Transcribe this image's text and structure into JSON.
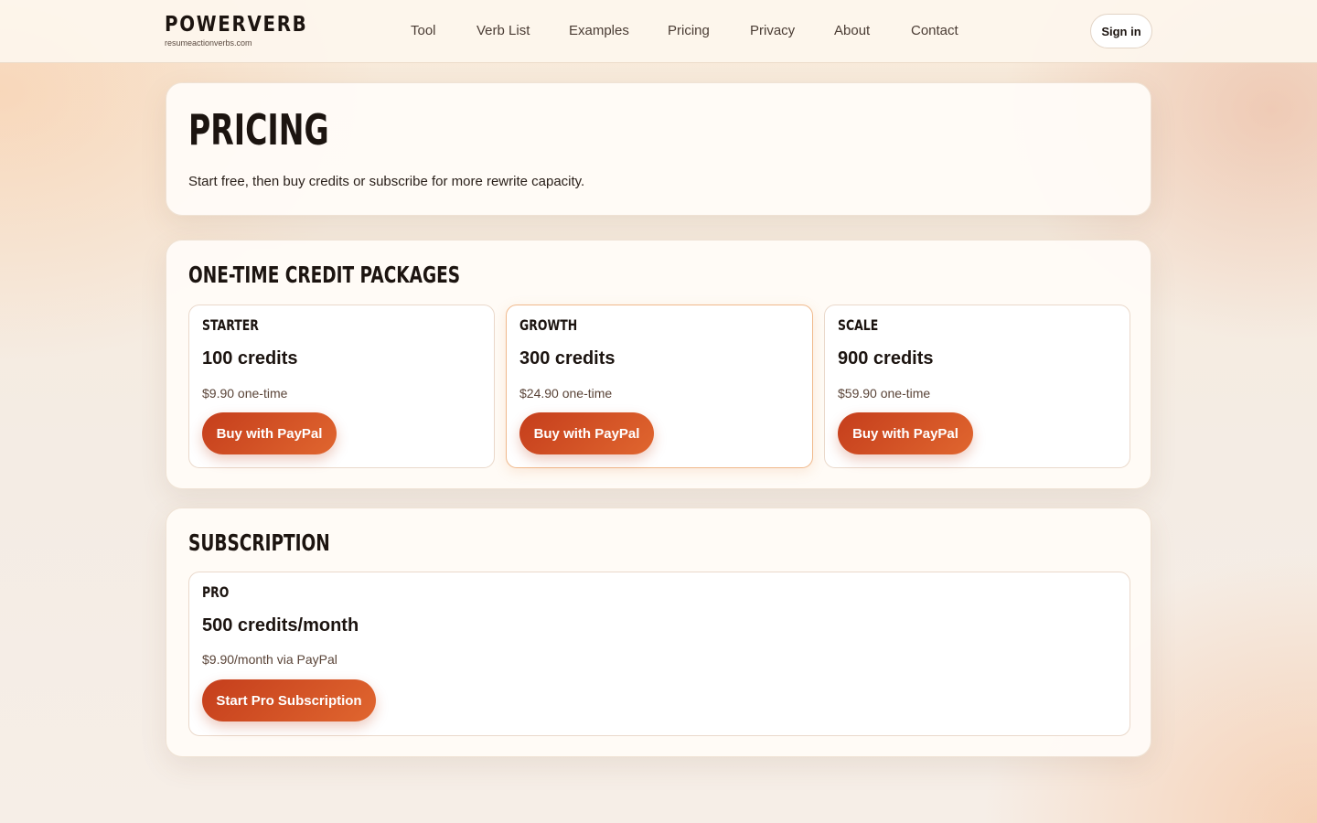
{
  "header": {
    "brand": "POWERVERB",
    "domain": "resumeactionverbs.com",
    "nav": [
      "Tool",
      "Verb List",
      "Examples",
      "Pricing",
      "Privacy",
      "About",
      "Contact"
    ],
    "sign_in": "Sign in"
  },
  "hero": {
    "title": "Pricing",
    "subtitle": "Start free, then buy credits or subscribe for more rewrite capacity."
  },
  "packages": {
    "title": "One-time credit packages",
    "plans": [
      {
        "name": "Starter",
        "credits": "100 credits",
        "price": "$9.90 one-time",
        "button": "Buy with PayPal"
      },
      {
        "name": "Growth",
        "credits": "300 credits",
        "price": "$24.90 one-time",
        "button": "Buy with PayPal"
      },
      {
        "name": "Scale",
        "credits": "900 credits",
        "price": "$59.90 one-time",
        "button": "Buy with PayPal"
      }
    ]
  },
  "subscription": {
    "title": "Subscription",
    "plan": {
      "name": "Pro",
      "credits": "500 credits/month",
      "price": "$9.90/month via PayPal",
      "button": "Start Pro Subscription"
    }
  },
  "colors": {
    "accent_start": "#c53e1c",
    "accent_end": "#e0662f",
    "text": "#1c1410",
    "featured_border": "#f0b98c"
  }
}
